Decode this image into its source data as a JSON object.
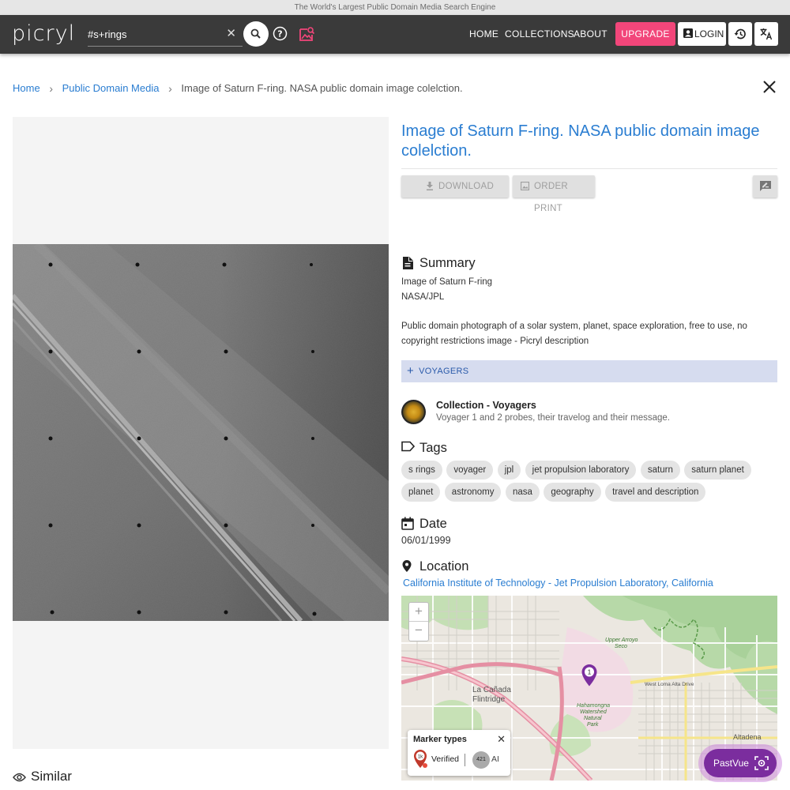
{
  "topstrip": {
    "text": "The World's Largest Public Domain Media Search Engine"
  },
  "header": {
    "logo": "picryl",
    "search": {
      "value": "#s+rings",
      "placeholder": ""
    },
    "nav": [
      "HOME",
      "COLLECTIONS",
      "ABOUT"
    ],
    "upgrade_label": "UPGRADE",
    "login_label": "LOGIN",
    "icons": [
      "close-icon",
      "search-icon",
      "help-icon",
      "image-search-icon",
      "account-icon",
      "history-icon",
      "translate-icon"
    ],
    "accent_color": "#f2467a"
  },
  "breadcrumb": {
    "home": "Home",
    "section": "Public Domain Media",
    "current": "Image of Saturn F-ring. NASA public domain image colelction."
  },
  "image": {
    "alt": "Image of Saturn F-ring"
  },
  "detail": {
    "title": "Image of Saturn F-ring. NASA public domain image colelction.",
    "download_label": "DOWNLOAD",
    "order_print_label": "ORDER PRINT",
    "summary_heading": "Summary",
    "summary_line1": "Image of Saturn F-ring",
    "summary_line2": "NASA/JPL",
    "description": "Public domain photograph of a solar system, planet, space exploration, free to use, no copyright restrictions image - Picryl description",
    "collection_chip": "VOYAGERS",
    "collection_title": "Collection - Voyagers",
    "collection_desc": "Voyager 1 and 2 probes, their travelog and their message.",
    "tags_heading": "Tags",
    "tags": [
      "s rings",
      "voyager",
      "jpl",
      "jet propulsion laboratory",
      "saturn",
      "saturn planet",
      "planet",
      "astronomy",
      "nasa",
      "geography",
      "travel and description"
    ],
    "date_heading": "Date",
    "date": "06/01/1999",
    "location_heading": "Location",
    "location": "California Institute of Technology - Jet Propulsion Laboratory, California"
  },
  "map": {
    "zoom_in": "+",
    "zoom_out": "−",
    "marker_label": "1",
    "labels": [
      "La Cañada Flintridge",
      "Altadena",
      "Upper Arroyo Seco",
      "Hahamongna Watershed Natural Park",
      "West Loma Alta Drive"
    ],
    "legend": {
      "title": "Marker types",
      "verified_badge": "1k",
      "verified": "Verified",
      "ai_count": "421",
      "ai": "AI"
    }
  },
  "similar_heading": "Similar",
  "pastvue_label": "PastVue",
  "colors": {
    "link": "#2a7dd1",
    "navbar": "#3a3a3a",
    "chip": "#d6dcef",
    "pastvue": "#7b2d9e"
  }
}
